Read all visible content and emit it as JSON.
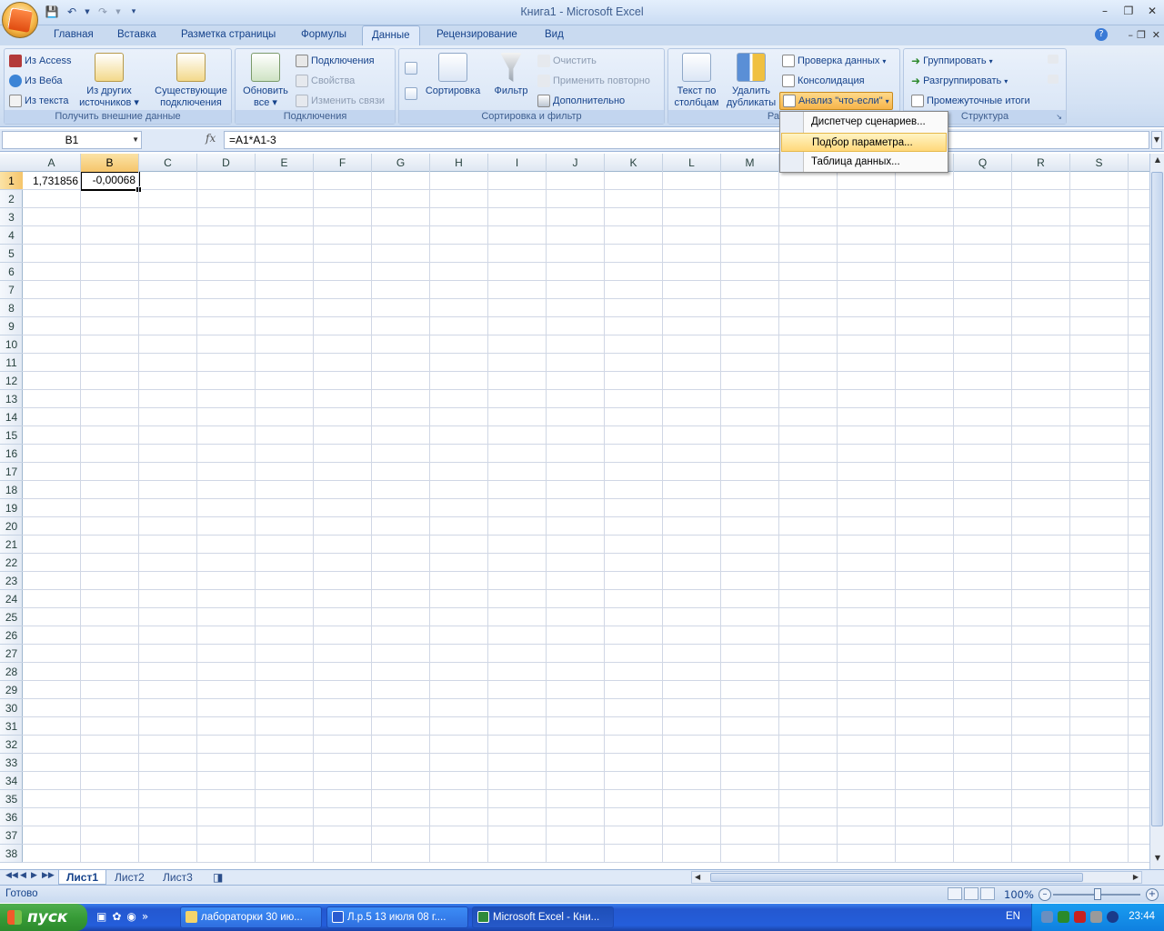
{
  "app": {
    "title": "Книга1 - Microsoft Excel"
  },
  "tabs": [
    "Главная",
    "Вставка",
    "Разметка страницы",
    "Формулы",
    "Данные",
    "Рецензирование",
    "Вид"
  ],
  "active_tab": "Данные",
  "ribbon": {
    "get_external": {
      "label": "Получить внешние данные",
      "from_access": "Из Access",
      "from_web": "Из Веба",
      "from_text": "Из текста",
      "other_sources_1": "Из других",
      "other_sources_2": "источников",
      "existing_1": "Существующие",
      "existing_2": "подключения"
    },
    "connections": {
      "label": "Подключения",
      "refresh_1": "Обновить",
      "refresh_2": "все",
      "connections": "Подключения",
      "properties": "Свойства",
      "edit_links": "Изменить связи"
    },
    "sort_filter": {
      "label": "Сортировка и фильтр",
      "sort": "Сортировка",
      "filter": "Фильтр",
      "clear": "Очистить",
      "reapply": "Применить повторно",
      "advanced": "Дополнительно"
    },
    "data_tools": {
      "label": "Работа",
      "text_to_cols_1": "Текст по",
      "text_to_cols_2": "столбцам",
      "remove_dup_1": "Удалить",
      "remove_dup_2": "дубликаты",
      "validation": "Проверка данных",
      "consolidate": "Консолидация",
      "what_if": "Анализ \"что-если\""
    },
    "outline": {
      "label": "Структура",
      "group": "Группировать",
      "ungroup": "Разгруппировать",
      "subtotal": "Промежуточные итоги"
    }
  },
  "whatif_menu": {
    "items": [
      "Диспетчер сценариев...",
      "Подбор параметра...",
      "Таблица данных..."
    ],
    "highlighted": "Подбор параметра..."
  },
  "formula_bar": {
    "name_box": "B1",
    "fx": "fx",
    "formula": "=A1*A1-3"
  },
  "grid": {
    "columns": [
      "A",
      "B",
      "C",
      "D",
      "E",
      "F",
      "G",
      "H",
      "I",
      "J",
      "K",
      "L",
      "M",
      "N",
      "O",
      "P",
      "Q",
      "R",
      "S"
    ],
    "selected_column": "B",
    "rows": 38,
    "selected_row": 1,
    "cells": {
      "A1": "1,731856",
      "B1": "-0,00068"
    }
  },
  "sheets": [
    "Лист1",
    "Лист2",
    "Лист3"
  ],
  "active_sheet": "Лист1",
  "status": {
    "ready": "Готово",
    "zoom": "100%"
  },
  "taskbar": {
    "start": "пуск",
    "buttons": [
      "лабораторки 30 ию...",
      "Л.р.5  13 июля 08 г....",
      "Microsoft Excel - Кни..."
    ],
    "lang": "EN",
    "clock": "23:44"
  }
}
